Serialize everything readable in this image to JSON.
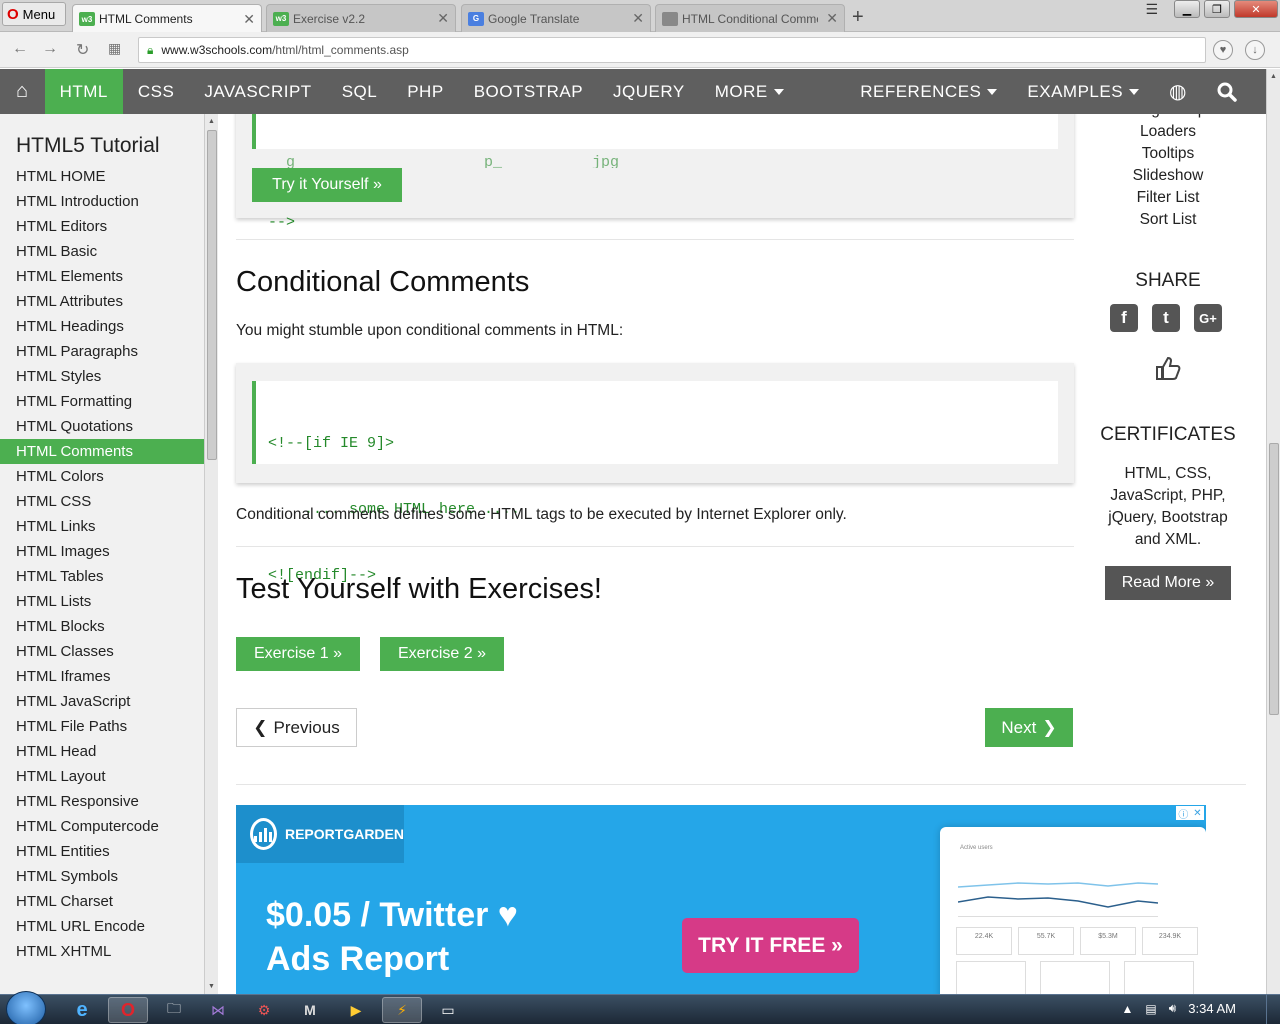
{
  "browser": {
    "menu_label": "Menu",
    "tabs": [
      {
        "title": "HTML Comments",
        "favicon": "w3",
        "favicon_color": "#4caf50",
        "active": true
      },
      {
        "title": "Exercise v2.2",
        "favicon": "w3",
        "favicon_color": "#4caf50",
        "active": false
      },
      {
        "title": "Google Translate",
        "favicon": "G",
        "favicon_color": "#4a7fe0",
        "active": false
      },
      {
        "title": "HTML Conditional Comme",
        "favicon": "page",
        "favicon_color": "#888",
        "active": false
      }
    ],
    "url_domain": "www.w3schools.com",
    "url_path": "/html/html_comments.asp"
  },
  "topnav": {
    "items": [
      "HTML",
      "CSS",
      "JAVASCRIPT",
      "SQL",
      "PHP",
      "BOOTSTRAP",
      "JQUERY",
      "MORE"
    ],
    "right_items": [
      "REFERENCES",
      "EXAMPLES"
    ],
    "active": "HTML",
    "accent": "#4caf50",
    "bar_color": "#5f5f5f"
  },
  "sidebar": {
    "title": "HTML5 Tutorial",
    "items": [
      "HTML HOME",
      "HTML Introduction",
      "HTML Editors",
      "HTML Basic",
      "HTML Elements",
      "HTML Attributes",
      "HTML Headings",
      "HTML Paragraphs",
      "HTML Styles",
      "HTML Formatting",
      "HTML Quotations",
      "HTML Comments",
      "HTML Colors",
      "HTML CSS",
      "HTML Links",
      "HTML Images",
      "HTML Tables",
      "HTML Lists",
      "HTML Blocks",
      "HTML Classes",
      "HTML Iframes",
      "HTML JavaScript",
      "HTML File Paths",
      "HTML Head",
      "HTML Layout",
      "HTML Responsive",
      "HTML Computercode",
      "HTML Entities",
      "HTML Symbols",
      "HTML Charset",
      "HTML URL Encode",
      "HTML XHTML"
    ],
    "active_index": 11
  },
  "main": {
    "top_code_end": "-->",
    "try_button": "Try it Yourself »",
    "section_title": "Conditional Comments",
    "intro": "You might stumble upon conditional comments in HTML:",
    "code_lines": [
      "<!--[if IE 9]>",
      "    .... some HTML here ....",
      "<![endif]-->"
    ],
    "explanation": "Conditional comments defines some HTML tags to be executed by Internet Explorer only.",
    "exercises_title": "Test Yourself with Exercises!",
    "exercise1": "Exercise 1 »",
    "exercise2": "Exercise 2 »",
    "prev_label": "Previous",
    "next_label": "Next"
  },
  "rightcol": {
    "links": [
      "Google Maps",
      "Loaders",
      "Tooltips",
      "Slideshow",
      "Filter List",
      "Sort List"
    ],
    "share_title": "SHARE",
    "social": [
      "facebook-icon",
      "twitter-icon",
      "google-plus-icon"
    ],
    "cert_title": "CERTIFICATES",
    "cert_text": "HTML, CSS, JavaScript, PHP, jQuery, Bootstrap and XML.",
    "read_more": "Read More »"
  },
  "ad": {
    "brand": "REPORTGARDEN",
    "headline_line1": "$0.05 / Twitter ♥",
    "headline_line2": "Ads Report",
    "cta": "TRY IT FREE »",
    "dash_label": "Active users",
    "stats": [
      "22.4K",
      "55.7K",
      "$5.3M",
      "234.9K"
    ]
  },
  "taskbar": {
    "time": "3:34 AM"
  }
}
